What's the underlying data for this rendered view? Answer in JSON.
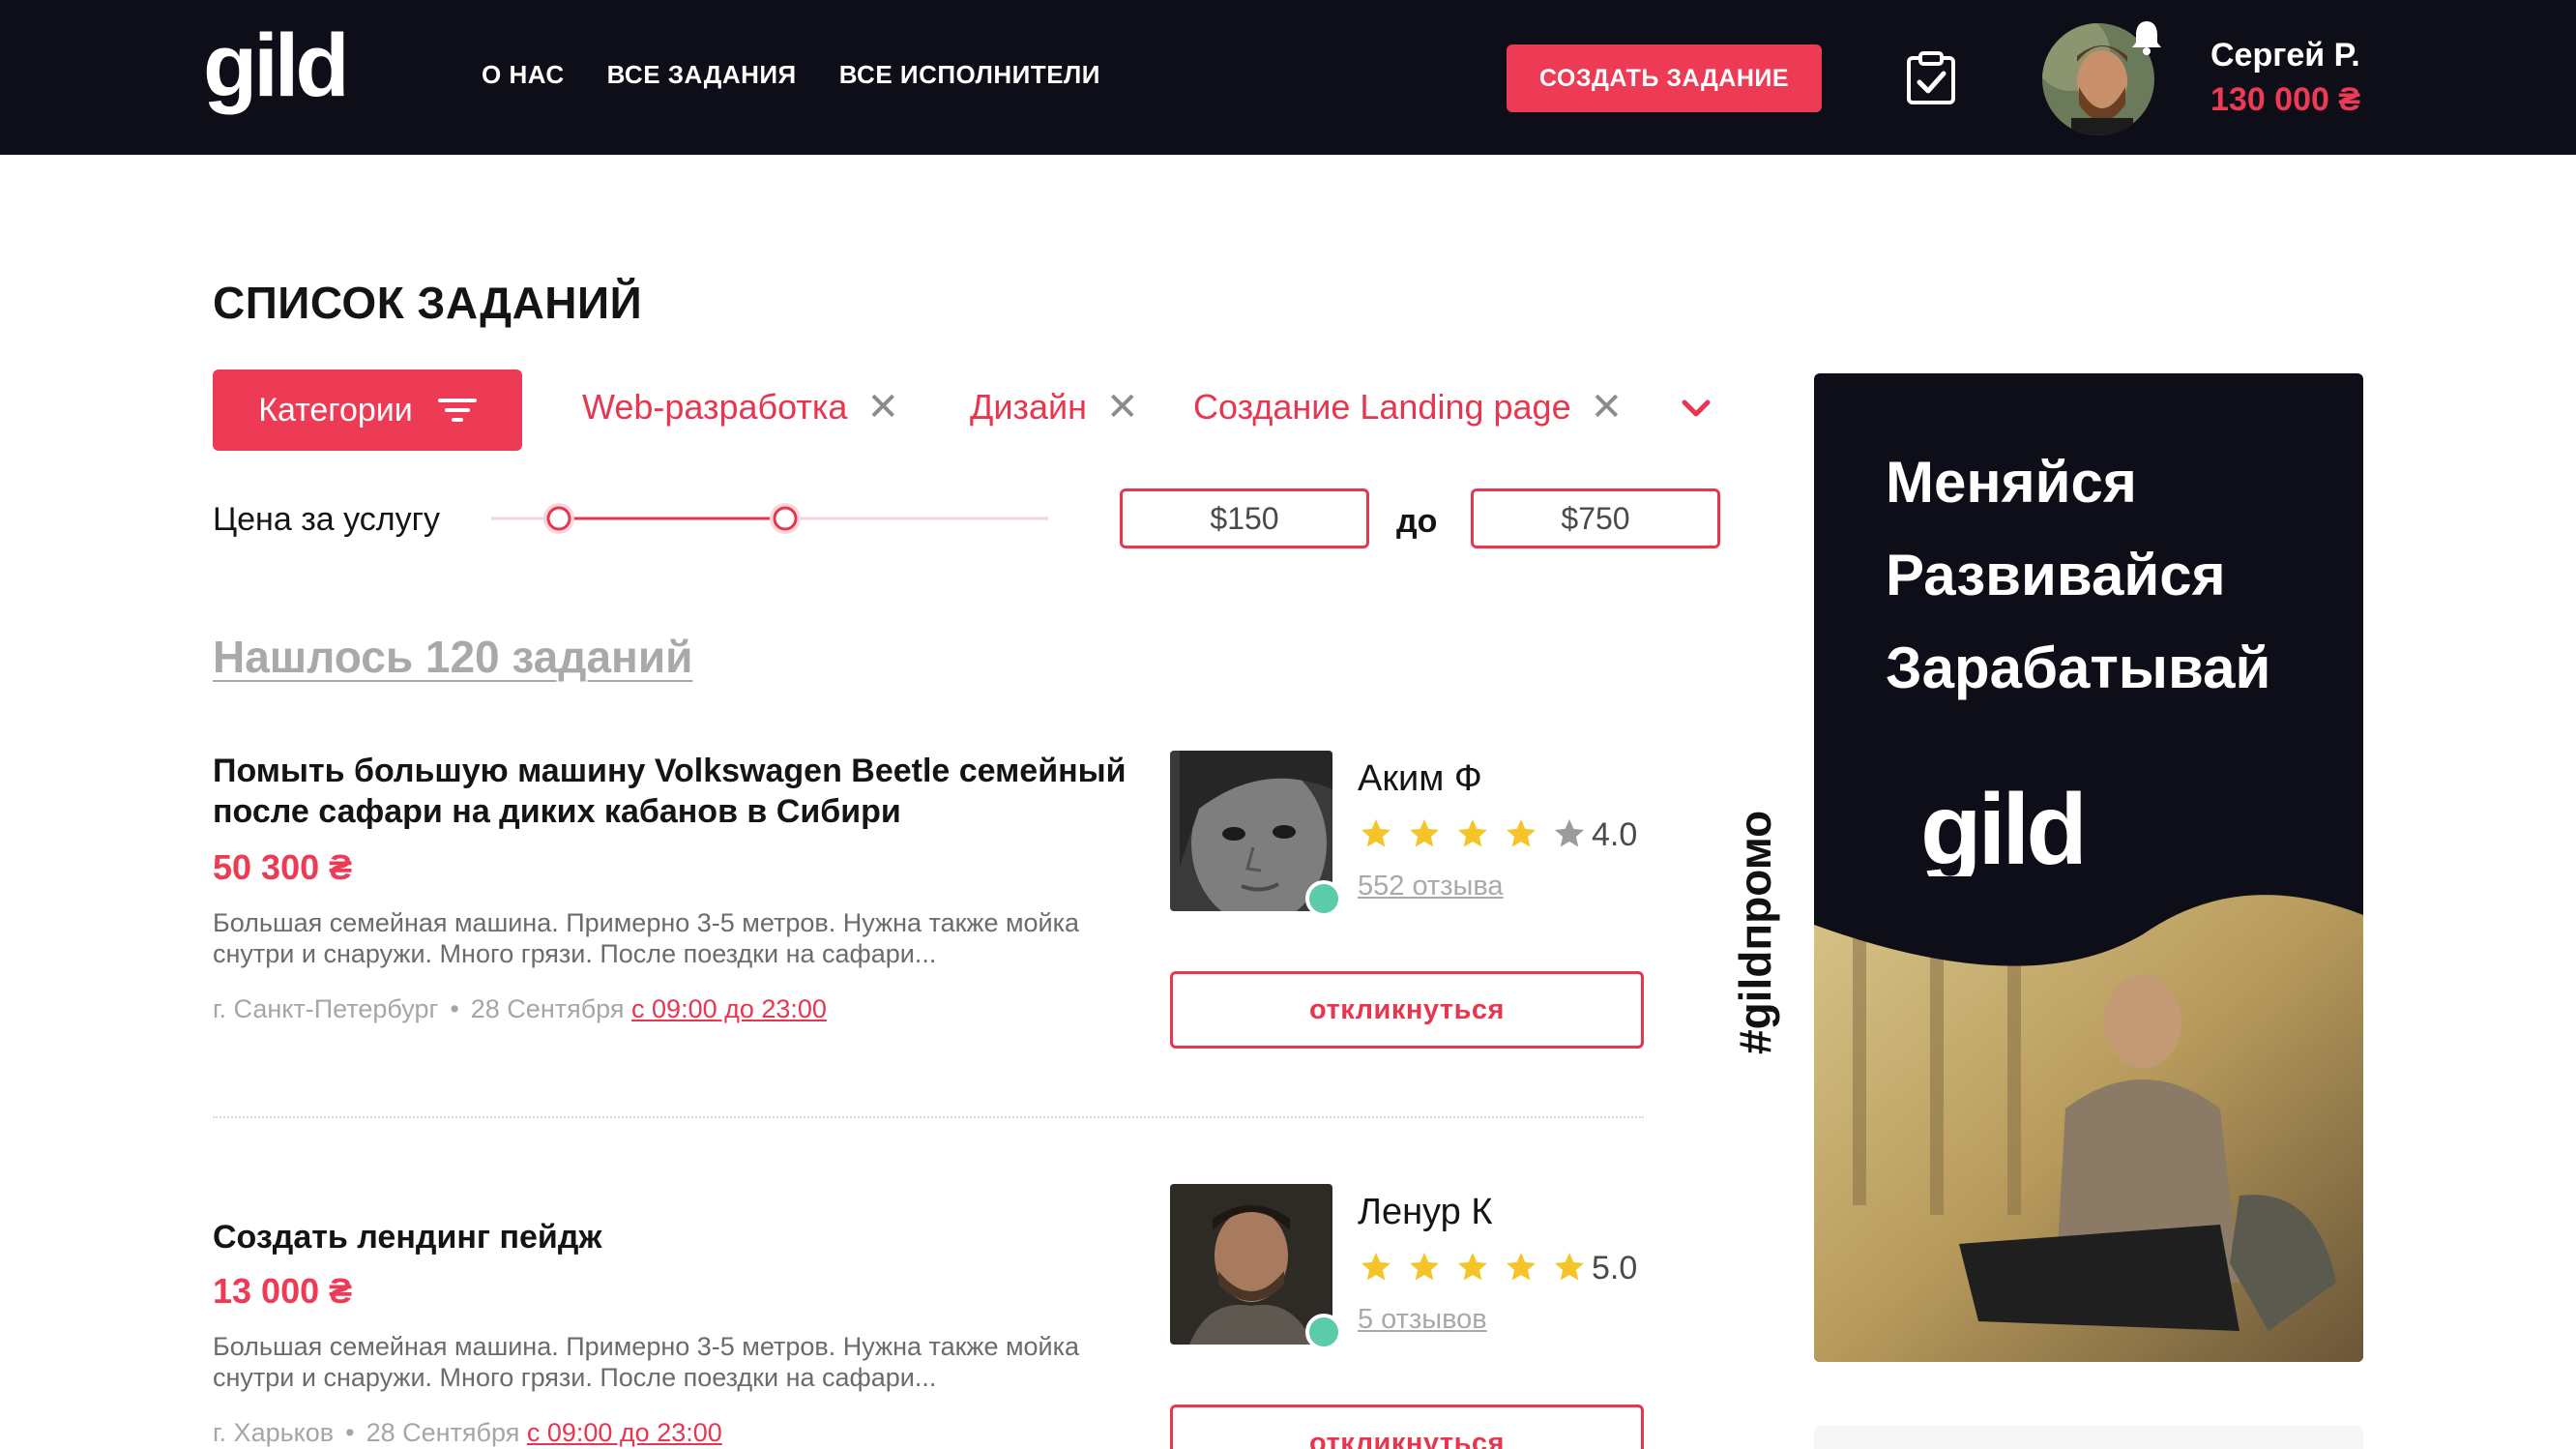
{
  "header": {
    "logo": "gild",
    "nav": [
      "О НАС",
      "ВСЕ ЗАДАНИЯ",
      "ВСЕ ИСПОЛНИТЕЛИ"
    ],
    "create_label": "СОЗДАТЬ ЗАДАНИЕ",
    "user_name": "Сергей Р.",
    "user_balance": "130 000 ₴"
  },
  "page": {
    "title": "СПИСОК ЗАДАНИЙ",
    "categories_label": "Категории",
    "chips": [
      "Web-разработка",
      "Дизайн",
      "Создание Landing page"
    ],
    "price_label": "Цена за услугу",
    "price_from": "$150",
    "price_to": "$750",
    "price_separator": "до",
    "found": "Нашлось 120 заданий"
  },
  "tasks": [
    {
      "title": "Помыть большую машину Volkswagen Beetle семейный после сафари на диких кабанов в Сибири",
      "price": "50 300 ₴",
      "description": "Большая семейная машина. Примерно 3-5 метров. Нужна также мойка снутри и снаружи. Много грязи. После поездки на сафари...",
      "city": "г. Санкт-Петербург",
      "date": "28 Сентября",
      "time": "с 09:00 до 23:00",
      "performer": {
        "name": "Аким Ф",
        "rating": "4.0",
        "stars": 4,
        "reviews": "552 отзыва"
      },
      "respond_label": "откликнуться"
    },
    {
      "title": "Создать лендинг пейдж",
      "price": "13 000 ₴",
      "description": "Большая семейная машина. Примерно 3-5 метров. Нужна также мойка снутри и снаружи. Много грязи. После поездки на сафари...",
      "city": "г. Харьков",
      "date": "28 Сентября",
      "time": "с 09:00 до 23:00",
      "performer": {
        "name": "Ленур К",
        "rating": "5.0",
        "stars": 5,
        "reviews": "5 отзывов"
      },
      "respond_label": "откликнуться"
    }
  ],
  "promo": {
    "lines": [
      "Меняйся",
      "Развивайся",
      "Зарабатывай"
    ],
    "logo": "gild",
    "hashtag": "#gildпромо"
  },
  "colors": {
    "accent": "#ed3a55",
    "header_bg": "#0d0e17",
    "online": "#5ccbab",
    "star": "#f4c428"
  },
  "icons": [
    "filter-icon",
    "close-icon",
    "chevron-down-icon",
    "clipboard-check-icon",
    "bell-icon",
    "star-icon"
  ]
}
